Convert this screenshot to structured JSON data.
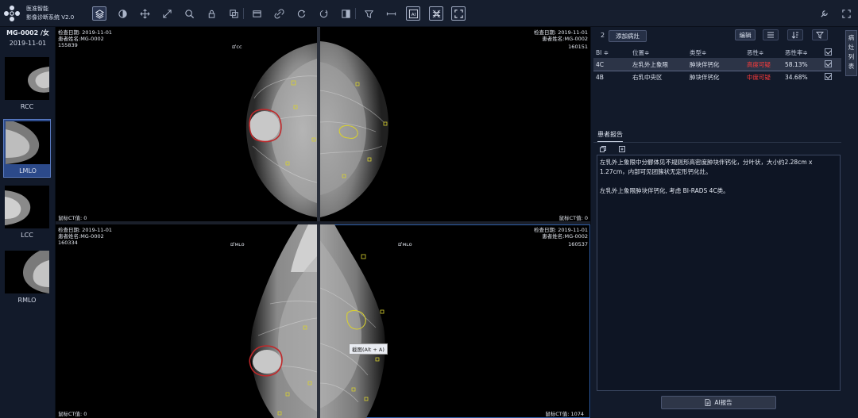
{
  "app": {
    "name_line1": "医准智能",
    "name_line2": "影像诊断系统 V2.0"
  },
  "toolbar": {
    "icons": [
      "layers-icon",
      "contrast-icon",
      "pan-icon",
      "zoom-fit-icon",
      "magnifier-icon",
      "lock-icon",
      "duplicate-icon",
      "window-icon",
      "link-icon",
      "rotate-icon",
      "reset-icon",
      "invert-icon",
      "calibrate-icon",
      "ruler-icon",
      "ai-icon",
      "grid-icon",
      "fullscreen-icon",
      "settings-icon",
      "expand-icon"
    ],
    "ai_label": "AI"
  },
  "sidebar": {
    "patient": "MG-0002 /女",
    "date": "2019-11-01",
    "thumbs": [
      {
        "label": "RCC"
      },
      {
        "label": "LMLO"
      },
      {
        "label": "LCC"
      },
      {
        "label": "RMLO"
      }
    ]
  },
  "viewports": [
    {
      "date": "检查日期: 2019-11-01",
      "name": "患者姓名:MG-0002",
      "id_left": "155839",
      "mark": "ꕠᴄᴄ",
      "ct": "鼠标CT值: 0"
    },
    {
      "date": "检查日期: 2019-11-01",
      "name": "患者姓名:MG-0002",
      "id_right": "160151",
      "ct": "鼠标CT值: 0"
    },
    {
      "date": "检查日期: 2019-11-01",
      "name": "患者姓名:MG-0002",
      "id_left": "160334",
      "mark": "ꕠᴍʟᴏ",
      "ct": "鼠标CT值: 0"
    },
    {
      "date": "检查日期: 2019-11-01",
      "name": "患者姓名:MG-0002",
      "id_right": "160537",
      "mark": "ꕠᴍʟᴏ",
      "ct": "鼠标CT值: 1074"
    }
  ],
  "tooltip": "截图(Alt + A)",
  "lesions": {
    "count": "2",
    "add_label": "添加病灶",
    "edit_label": "编辑",
    "headers": [
      "BI ≑",
      "位置≑",
      "类型≑",
      "恶性≑",
      "恶性率≑"
    ],
    "rows": [
      {
        "bi": "4C",
        "pos": "左乳外上象限",
        "type": "肿块伴钙化",
        "mal": "高度可疑",
        "rate": "58.13%"
      },
      {
        "bi": "4B",
        "pos": "右乳中央区",
        "type": "肿块伴钙化",
        "mal": "中度可疑",
        "rate": "34.68%"
      }
    ]
  },
  "report": {
    "tab": "患者报告",
    "p1": "左乳外上象限中分髎体见不规则形高密度肿块伴钙化，分叶状，大小约2.28cm x 1.27cm，内部可见团簇状无定形钙化灶。",
    "p2": "左乳外上象限肿块伴钙化, 考虑 BI-RADS 4C类。",
    "ai_button": "AI报告"
  },
  "side_tab": "病灶列表",
  "colors": {
    "accent": "#2c4a8a",
    "danger": "#ff3b3b",
    "lesion_red": "#c0282a",
    "lesion_yellow": "#d8d030"
  }
}
